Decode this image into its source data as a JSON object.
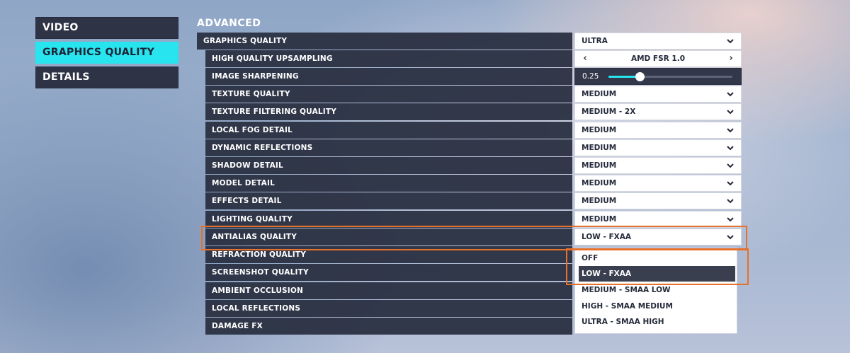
{
  "categories": [
    {
      "label": "VIDEO",
      "active": false
    },
    {
      "label": "GRAPHICS QUALITY",
      "active": true
    },
    {
      "label": "DETAILS",
      "active": false
    }
  ],
  "section_title": "ADVANCED",
  "rows": {
    "graphics_quality": {
      "label": "GRAPHICS QUALITY",
      "value": "ULTRA"
    },
    "upsampling": {
      "label": "HIGH QUALITY UPSAMPLING",
      "value": "AMD FSR 1.0"
    },
    "sharpening": {
      "label": "IMAGE SHARPENING",
      "value": "0.25",
      "level": 0.25
    },
    "texture_quality": {
      "label": "TEXTURE QUALITY",
      "value": "MEDIUM"
    },
    "texture_filtering": {
      "label": "TEXTURE FILTERING QUALITY",
      "value": "MEDIUM - 2X"
    },
    "local_fog": {
      "label": "LOCAL FOG DETAIL",
      "value": "MEDIUM"
    },
    "dynamic_reflections": {
      "label": "DYNAMIC REFLECTIONS",
      "value": "MEDIUM"
    },
    "shadow_detail": {
      "label": "SHADOW DETAIL",
      "value": "MEDIUM"
    },
    "model_detail": {
      "label": "MODEL DETAIL",
      "value": "MEDIUM"
    },
    "effects_detail": {
      "label": "EFFECTS DETAIL",
      "value": "MEDIUM"
    },
    "lighting_quality": {
      "label": "LIGHTING QUALITY",
      "value": "MEDIUM"
    },
    "antialias_quality": {
      "label": "ANTIALIAS QUALITY",
      "value": "LOW - FXAA"
    },
    "refraction_quality": {
      "label": "REFRACTION QUALITY"
    },
    "screenshot_quality": {
      "label": "SCREENSHOT QUALITY"
    },
    "ambient_occlusion": {
      "label": "AMBIENT OCCLUSION"
    },
    "local_reflections": {
      "label": "LOCAL REFLECTIONS"
    },
    "damage_fx": {
      "label": "DAMAGE FX"
    }
  },
  "antialias_options": [
    "OFF",
    "LOW - FXAA",
    "MEDIUM - SMAA LOW",
    "HIGH - SMAA MEDIUM",
    "ULTRA - SMAA HIGH"
  ],
  "antialias_selected": "LOW - FXAA",
  "colors": {
    "accent": "#27e4ee",
    "highlight": "#e7702a",
    "panel": "#2c3244"
  }
}
